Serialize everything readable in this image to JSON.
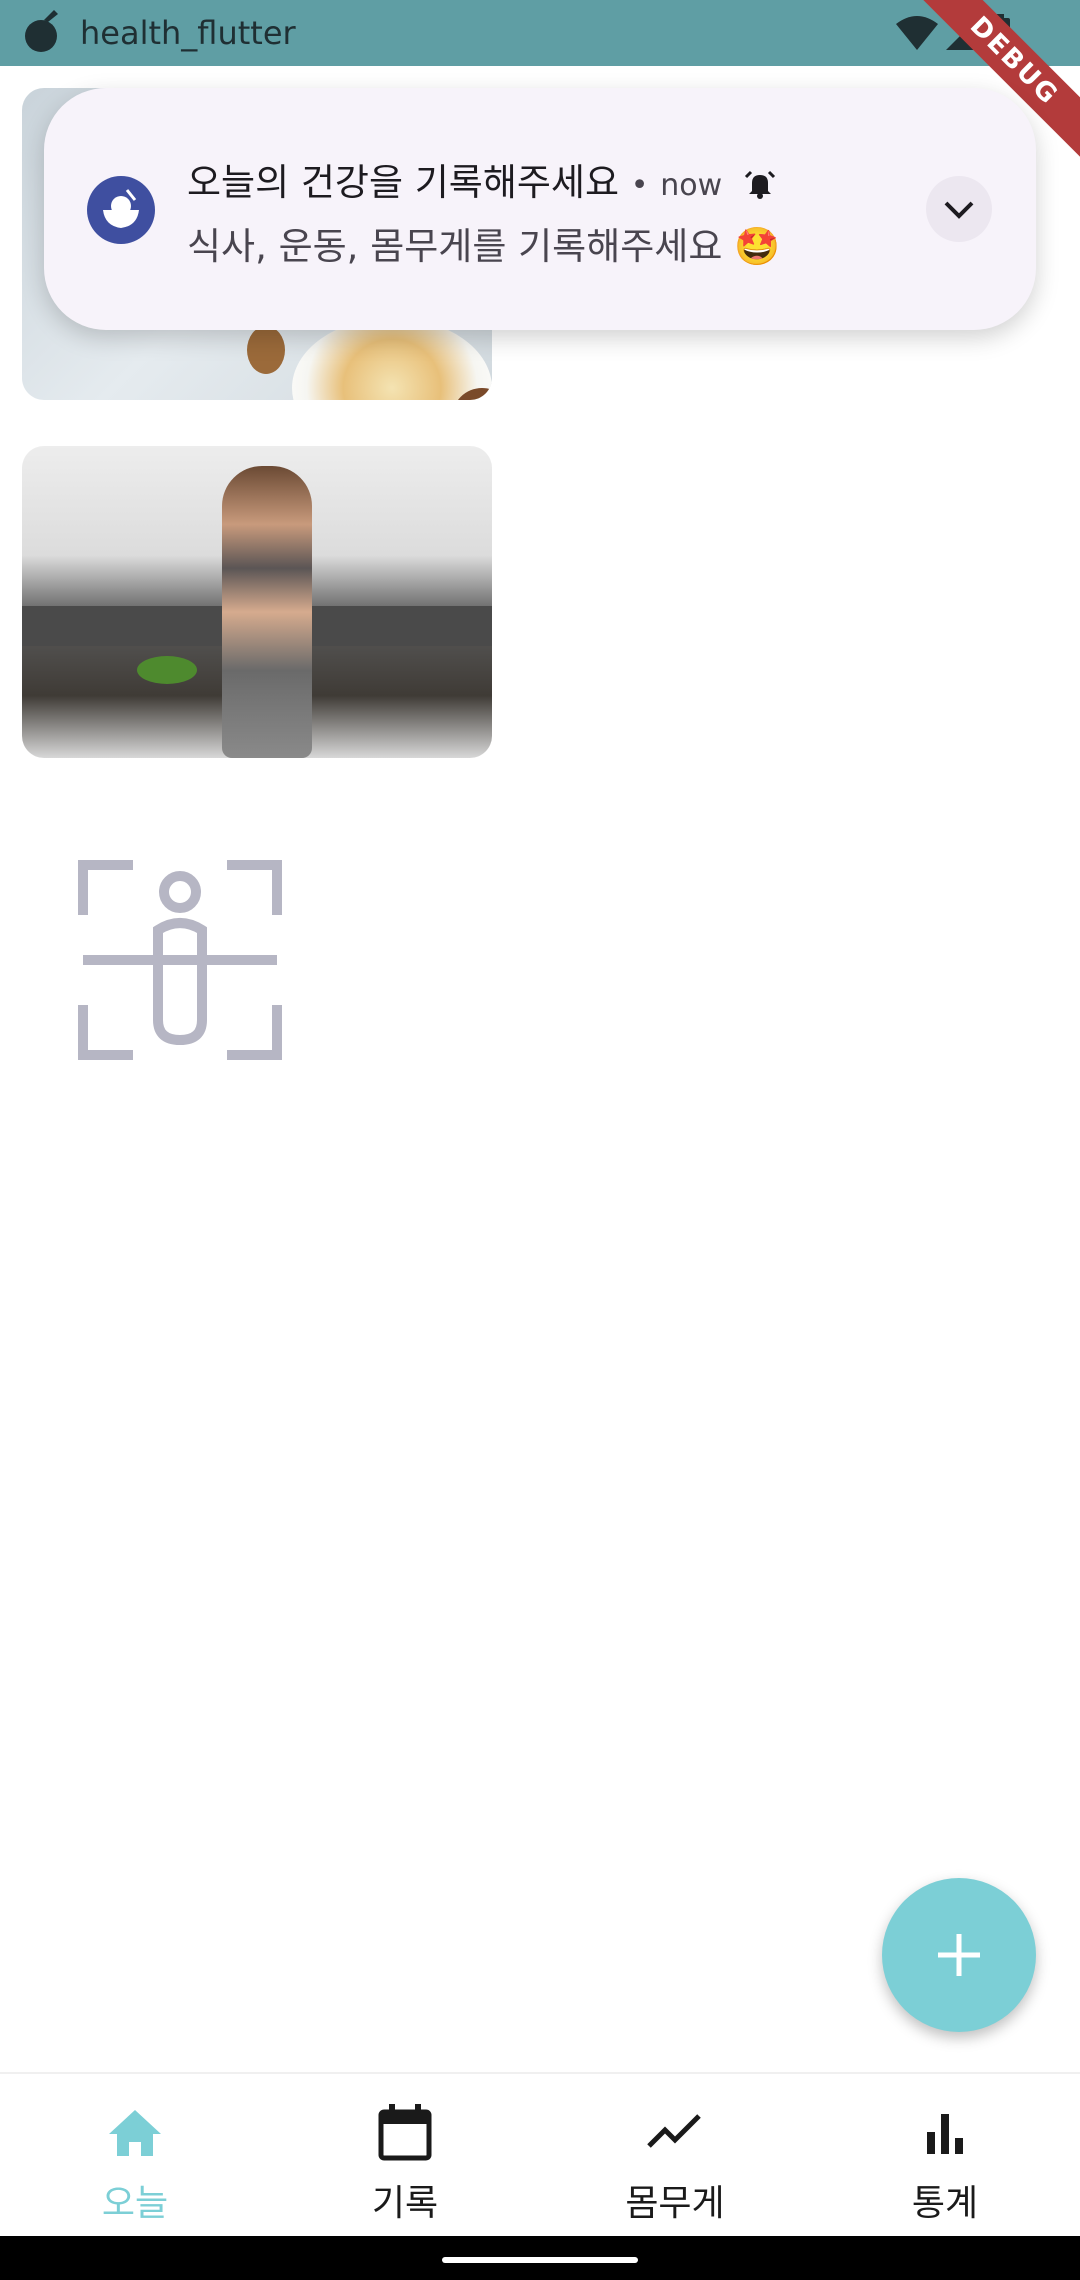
{
  "status_bar": {
    "app_name": "health_flutter",
    "debug_label": "DEBUG"
  },
  "notification": {
    "title": "오늘의 건강을 기록해주세요",
    "separator": "•",
    "time": "now",
    "body": "식사, 운동, 몸무게를 기록해주세요 🤩"
  },
  "nav": {
    "items": [
      {
        "label": "오늘",
        "icon": "home-icon",
        "active": true
      },
      {
        "label": "기록",
        "icon": "calendar-icon",
        "active": false
      },
      {
        "label": "몸무게",
        "icon": "trend-line-icon",
        "active": false
      },
      {
        "label": "통계",
        "icon": "bar-chart-icon",
        "active": false
      }
    ]
  },
  "colors": {
    "status_bar": "#5f9ea4",
    "accent": "#7ccfd6",
    "notification_bg": "#f7f3fa",
    "debug": "#b33b3b"
  }
}
